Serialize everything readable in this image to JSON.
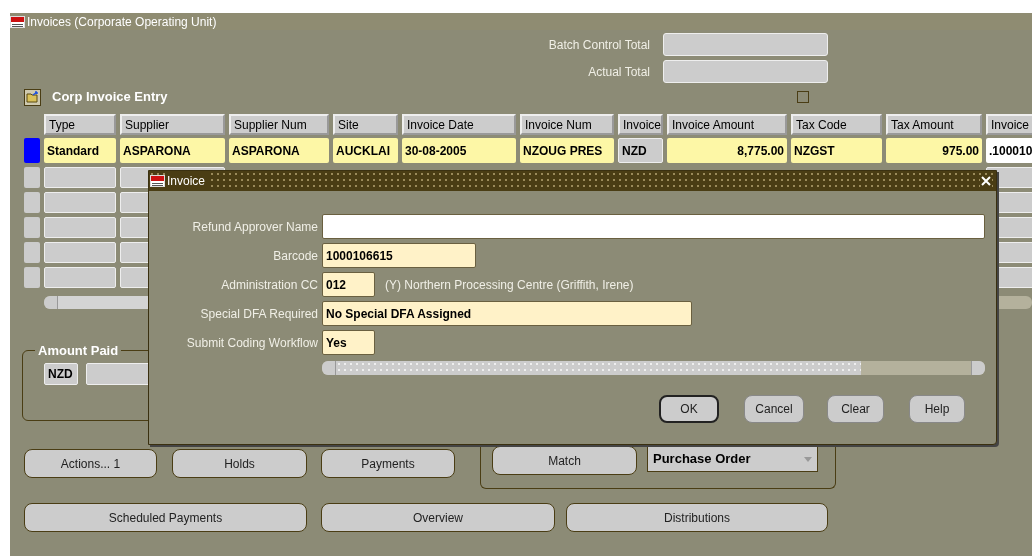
{
  "window": {
    "title": "Invoices (Corporate Operating Unit)"
  },
  "totals": [
    {
      "label": "Batch Control Total"
    },
    {
      "label": "Actual Total"
    }
  ],
  "block": {
    "title": "Corp Invoice Entry",
    "checkbox": {
      "checked": false
    }
  },
  "table": {
    "columns": [
      "Type",
      "Supplier",
      "Supplier Num",
      "Site",
      "Invoice Date",
      "Invoice Num",
      "Invoice",
      "Invoice Amount",
      "Tax Code",
      "Tax Amount",
      "Invoice"
    ],
    "rows": [
      {
        "selected": true,
        "cells": [
          {
            "kind": "text",
            "value": "Standard"
          },
          {
            "kind": "text",
            "value": "ASPARONA"
          },
          {
            "kind": "text",
            "value": "ASPARONA"
          },
          {
            "kind": "text",
            "value": "AUCKLAI"
          },
          {
            "kind": "text",
            "value": "30-08-2005"
          },
          {
            "kind": "text",
            "value": "NZOUG PRES"
          },
          {
            "kind": "readonly",
            "value": "NZD"
          },
          {
            "kind": "amount",
            "value": "8,775.00"
          },
          {
            "kind": "text",
            "value": "NZGST"
          },
          {
            "kind": "amount",
            "value": "975.00"
          },
          {
            "kind": "active",
            "value": ".100010"
          }
        ]
      }
    ]
  },
  "amount_paid": {
    "title": "Amount Paid",
    "currency": "NZD"
  },
  "dialog": {
    "title": "Invoice",
    "fields": [
      {
        "label": "Refund Approver Name",
        "kind": "wide"
      },
      {
        "label": "Barcode",
        "kind": "medium",
        "value": "1000106615"
      },
      {
        "label": "Administration CC",
        "kind": "short",
        "value": "012",
        "description": "(Y) Northern Processing Centre (Griffith, Irene)"
      },
      {
        "label": "Special DFA Required",
        "kind": "long",
        "value": "No Special DFA Assigned"
      },
      {
        "label": "Submit Coding Workflow",
        "kind": "short",
        "value": "Yes"
      }
    ],
    "buttons": [
      {
        "label": "OK",
        "default": true
      },
      {
        "label": "Cancel",
        "default": false
      },
      {
        "label": "Clear",
        "default": false
      },
      {
        "label": "Help",
        "default": false
      }
    ]
  },
  "buttons_row_1": [
    "Actions... 1",
    "Holds",
    "Payments"
  ],
  "match": {
    "button": "Match",
    "dropdown": "Purchase Order"
  },
  "buttons_row_2": [
    "Scheduled Payments",
    "Overview",
    "Distributions"
  ]
}
